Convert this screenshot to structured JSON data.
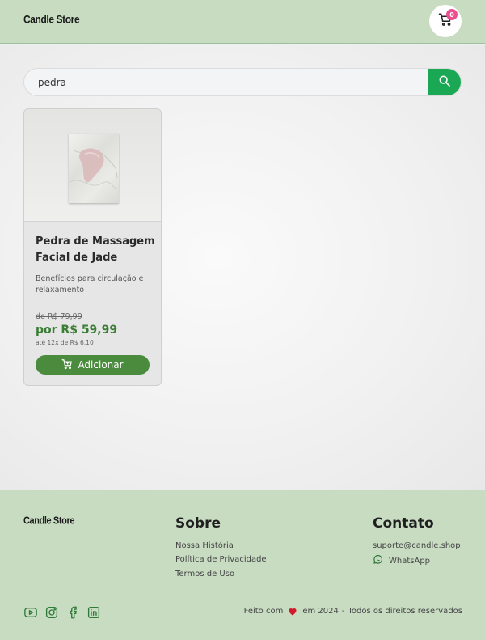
{
  "header": {
    "logo": "Candle Store",
    "cart_count": "0"
  },
  "search": {
    "value": "pedra",
    "placeholder": ""
  },
  "product": {
    "title": "Pedra de Massagem Facial de Jade",
    "description": "Benefícios para circulação e relaxamento",
    "old_price": "de R$ 79,99",
    "price": "por R$ 59,99",
    "installments": "até 12x de R$ 6,10",
    "add_label": "Adicionar"
  },
  "footer": {
    "logo": "Candle Store",
    "sobre": {
      "title": "Sobre",
      "links": [
        "Nossa História",
        "Política de Privacidade",
        "Termos de Uso"
      ]
    },
    "contato": {
      "title": "Contato",
      "email": "suporte@candle.shop",
      "whatsapp": "WhatsApp"
    },
    "social": [
      "youtube-icon",
      "instagram-icon",
      "facebook-icon",
      "linkedin-icon"
    ],
    "copyright": {
      "made_with": "Feito com",
      "year": "em 2024",
      "separator": "-",
      "rights": "Todos os direitos reservados"
    }
  },
  "colors": {
    "header_bg": "#c8dcc2",
    "accent_green": "#1aa855",
    "button_green": "#4b8b3e",
    "price_green": "#3a7d35",
    "badge_pink": "#ec4f8f",
    "heart_red": "#d11a2a"
  }
}
